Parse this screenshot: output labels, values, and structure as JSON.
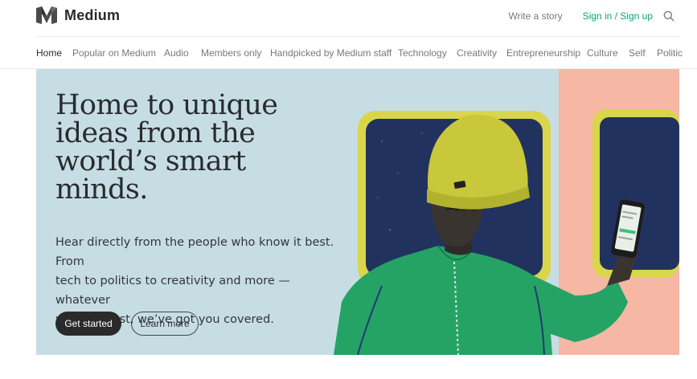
{
  "brand": {
    "name": "Medium"
  },
  "header": {
    "write_label": "Write a story",
    "sign_label": "Sign in / Sign up",
    "search_icon": "search-icon"
  },
  "nav": {
    "items": [
      {
        "label": "Home",
        "active": true
      },
      {
        "label": "Popular on Medium",
        "active": false
      },
      {
        "label": "Audio",
        "active": false
      },
      {
        "label": "Members only",
        "active": false
      },
      {
        "label": "Handpicked by Medium staff",
        "active": false
      },
      {
        "label": "Technology",
        "active": false
      },
      {
        "label": "Creativity",
        "active": false
      },
      {
        "label": "Entrepreneurship",
        "active": false
      },
      {
        "label": "Culture",
        "active": false
      },
      {
        "label": "Self",
        "active": false
      },
      {
        "label": "Politic",
        "active": false
      }
    ]
  },
  "hero": {
    "title": "Home to unique\nideas from the\nworld’s smart\nminds.",
    "subtitle": "Hear directly from the people who know it best. From\ntech to politics to creativity and more — whatever\nyour interest, we’ve got you covered.",
    "primary_button": "Get started",
    "secondary_button": "Learn more"
  },
  "colors": {
    "accent_green": "#03a87c",
    "hero_bg": "#c7dde4",
    "hat_yellow": "#c9c83a",
    "sweater_green": "#25a365",
    "panel_pink": "#f6b7a4",
    "panel_navy": "#22325f"
  }
}
